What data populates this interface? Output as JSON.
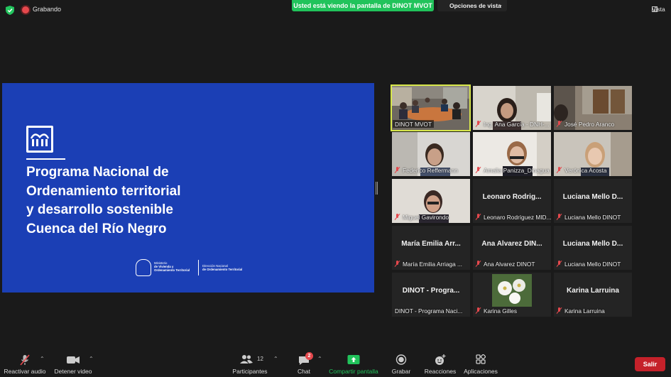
{
  "top": {
    "recording_label": "Grabando",
    "share_banner": "Usted está viendo la pantalla de DINOT MVOT",
    "view_options": "Opciones de vista",
    "view_label": "Vista"
  },
  "slide": {
    "title_lines": [
      "Programa Nacional de",
      "Ordenamiento territorial",
      "y desarrollo sostenible",
      "Cuenca del Río Negro"
    ],
    "ministry_lines": [
      "Ministerio",
      "de Vivienda y",
      "Ordenamiento Territorial"
    ],
    "direction_lines": [
      "Dirección Nacional",
      "de Ordenamiento Territorial"
    ]
  },
  "participants": [
    {
      "label": "DINOT MVOT",
      "name": "",
      "muted": false,
      "video": true
    },
    {
      "label": "Ing. Ana García - DNH-...",
      "name": "",
      "muted": true,
      "video": true
    },
    {
      "label": "José Pedro Aranco",
      "name": "",
      "muted": true,
      "video": true
    },
    {
      "label": "Federico Reffermann",
      "name": "",
      "muted": true,
      "video": true
    },
    {
      "label": "Amalia Panizza_Dinagua",
      "name": "",
      "muted": true,
      "video": true
    },
    {
      "label": "Verónica Acosta",
      "name": "",
      "muted": true,
      "video": true
    },
    {
      "label": "Miguel Gavirondo",
      "name": "",
      "muted": true,
      "video": true
    },
    {
      "label": "Leonaro Rodríguez MID...",
      "name": "Leonaro  Rodrig...",
      "muted": true,
      "video": false
    },
    {
      "label": "Luciana Mello DINOT",
      "name": "Luciana  Mello  D...",
      "muted": true,
      "video": false
    },
    {
      "label": "María Emilia Arriaga ...",
      "name": "María  Emilia  Arr...",
      "muted": true,
      "video": false
    },
    {
      "label": "Ana Alvarez DINOT",
      "name": "Ana  Alvarez  DIN...",
      "muted": true,
      "video": false
    },
    {
      "label": "Luciana Mello DINOT",
      "name": "Luciana  Mello  D...",
      "muted": true,
      "video": false
    },
    {
      "label": "DINOT - Programa Naci...",
      "name": "DINOT  -  Progra...",
      "muted": false,
      "video": false
    },
    {
      "label": "Karina Gilles",
      "name": "",
      "muted": true,
      "video": "flower"
    },
    {
      "label": "Karina Larruina",
      "name": "Karina  Larruina",
      "muted": true,
      "video": false
    }
  ],
  "toolbar": {
    "audio": "Reactivar audio",
    "video": "Detener video",
    "participants": "Participantes",
    "participants_count": "12",
    "chat": "Chat",
    "chat_badge": "2",
    "share": "Compartir pantalla",
    "record": "Grabar",
    "reactions": "Reacciones",
    "apps": "Aplicaciones",
    "leave": "Salir"
  },
  "colors": {
    "share_green": "#21c35b",
    "slide_blue": "#1b3fb5",
    "leave_red": "#c5212a",
    "active_speaker": "#d7e64a"
  }
}
